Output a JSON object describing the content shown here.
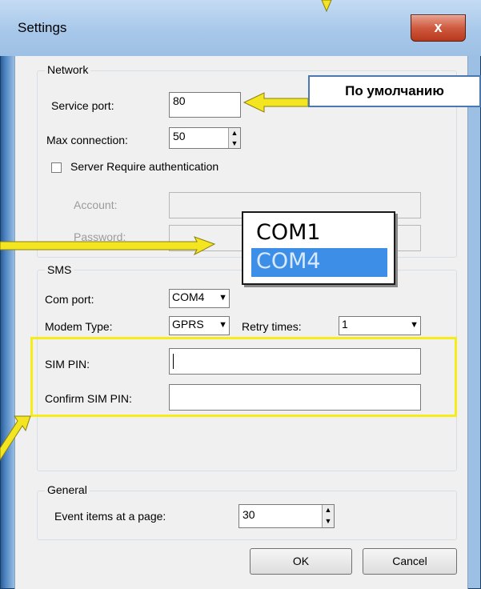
{
  "window": {
    "title": "Settings",
    "close_glyph": "x"
  },
  "callout": {
    "text": "По умолчанию"
  },
  "network": {
    "legend": "Network",
    "service_port_label": "Service port:",
    "service_port_value": "80",
    "max_connection_label": "Max connection:",
    "max_connection_value": "50",
    "auth_label": "Server Require authentication",
    "auth_checked": false,
    "account_label": "Account:",
    "password_label": "Password:"
  },
  "com_dropdown": {
    "options": [
      "COM1",
      "COM4"
    ],
    "selected": "COM4"
  },
  "sms": {
    "legend": "SMS",
    "com_port_label": "Com port:",
    "com_port_value": "COM4",
    "modem_type_label": "Modem Type:",
    "modem_type_value": "GPRS",
    "retry_label": "Retry times:",
    "retry_value": "1",
    "sim_pin_label": "SIM PIN:",
    "confirm_sim_pin_label": "Confirm SIM PIN:"
  },
  "general": {
    "legend": "General",
    "event_items_label": "Event items at a page:",
    "event_items_value": "30"
  },
  "buttons": {
    "ok": "OK",
    "cancel": "Cancel"
  },
  "colors": {
    "highlight": "#f6ec1a",
    "arrow": "#f3e51f",
    "selection": "#3d8ee6"
  }
}
